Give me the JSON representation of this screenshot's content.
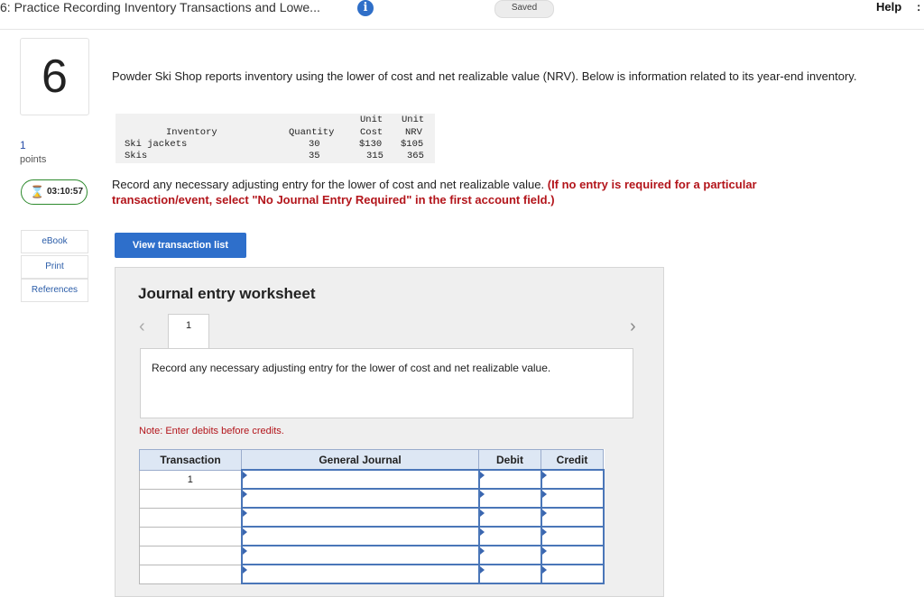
{
  "header": {
    "title": "6: Practice Recording Inventory Transactions and Lowe...",
    "info_icon": "info-icon",
    "saved_label": "Saved",
    "help_label": "Help",
    "more_label": ":"
  },
  "sidebar": {
    "question_number": "6",
    "points_value": "1",
    "points_label": "points",
    "timer": "03:10:57",
    "timer_icon": "hourglass-icon",
    "links": [
      {
        "label": "eBook"
      },
      {
        "label": "Print"
      },
      {
        "label": "References"
      }
    ]
  },
  "question": {
    "intro": "Powder Ski Shop reports inventory using the lower of cost and net realizable value (NRV). Below is information related to its year-end inventory.",
    "inventory_table": {
      "headers": {
        "inventory": "Inventory",
        "quantity": "Quantity",
        "unit_cost_line1": "Unit",
        "unit_cost_line2": "Cost",
        "unit_nrv_line1": "Unit",
        "unit_nrv_line2": "NRV"
      },
      "rows": [
        {
          "item": "Ski jackets",
          "quantity": "30",
          "cost": "$130",
          "nrv": "$105"
        },
        {
          "item": "Skis",
          "quantity": "35",
          "cost": "315",
          "nrv": "365"
        }
      ]
    },
    "instruction_plain": "Record any necessary adjusting entry for the lower of cost and net realizable value.",
    "instruction_red": "(If no entry is required for a particular transaction/event, select \"No Journal Entry Required\" in the first account field.)"
  },
  "view_button_label": "View transaction list",
  "worksheet": {
    "title": "Journal entry worksheet",
    "tab_label": "1",
    "prompt": "Record any necessary adjusting entry for the lower of cost and net realizable value.",
    "note": "Note: Enter debits before credits.",
    "columns": {
      "transaction": "Transaction",
      "general_journal": "General Journal",
      "debit": "Debit",
      "credit": "Credit"
    },
    "first_transaction": "1"
  }
}
